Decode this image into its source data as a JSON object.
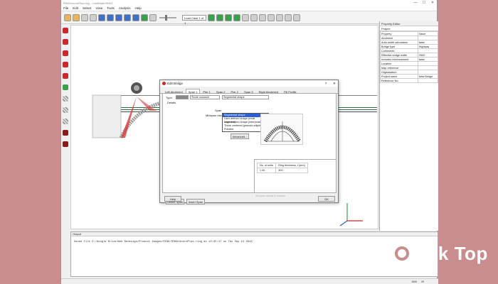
{
  "app": {
    "title": "RINGrecordPlus.ring - LimitState:RING",
    "menu": [
      "File",
      "Edit",
      "Select",
      "View",
      "Tools",
      "Analysis",
      "Help"
    ],
    "load_case": "Load Case 1 of 1",
    "win_min": "—",
    "win_max": "☐",
    "win_close": "✕"
  },
  "property_editor": {
    "title": "Property Editor",
    "project": "Project",
    "header_property": "Property",
    "header_value": "Value",
    "rows": [
      {
        "property": "Abutment",
        "value": ""
      },
      {
        "property": "Auto-width calculation",
        "value": "false"
      },
      {
        "property": "Bridge type",
        "value": "Highway"
      },
      {
        "property": "Comments",
        "value": ""
      },
      {
        "property": "Effective bridge width",
        "value": "2500"
      },
      {
        "property": "Includes reinforcement",
        "value": "false"
      },
      {
        "property": "Location",
        "value": ""
      },
      {
        "property": "Map reference",
        "value": ""
      },
      {
        "property": "Organisation",
        "value": ""
      },
      {
        "property": "Project name",
        "value": "New Bridge"
      },
      {
        "property": "Reference No.",
        "value": ""
      }
    ]
  },
  "output": {
    "title": "Output",
    "text": "Saved file D:/Google Drive/Web Redesign/Product Images/RING/RINGrecordPlus.ring at 12:25:47 on Thu Sep 12 2019"
  },
  "status": {
    "zoom": "1000",
    "pos": "29"
  },
  "dialog": {
    "title": "Edit Bridge",
    "help_q": "?",
    "close_x": "✕",
    "tabs": [
      "Left Abutment",
      "Span 1",
      "Pier 1",
      "Span 2",
      "Pier 2",
      "Span 3",
      "Right Abutment",
      "Fill Profile"
    ],
    "active_tab": 1,
    "type_label": "Type:",
    "type_value": "Stone voussoir",
    "shape_value": "Segmental shape",
    "details_label": "Details",
    "span_label": "Span",
    "midspan_label": "Midspan rise, r [mm]",
    "advanced_button": "Advanced...",
    "dropdown_options": [
      "Segmental shape",
      "User defined shape (multi segment)",
      "User defined shape (interpolated)",
      "Three centered (pseudo-elliptic)",
      "Pointed"
    ],
    "selected_option": 0,
    "grid_headers": [
      "No. of units",
      "Ring thickness, t [mm]"
    ],
    "grid_row": [
      "1",
      "40",
      "300"
    ],
    "checkbox_label": "Set joints normal to intrados",
    "delete_span": "Delete Span",
    "insert_span": "Insert Span",
    "help_button": "Help",
    "ok_button": "OK"
  },
  "watermark": {
    "text": "esk Top"
  }
}
